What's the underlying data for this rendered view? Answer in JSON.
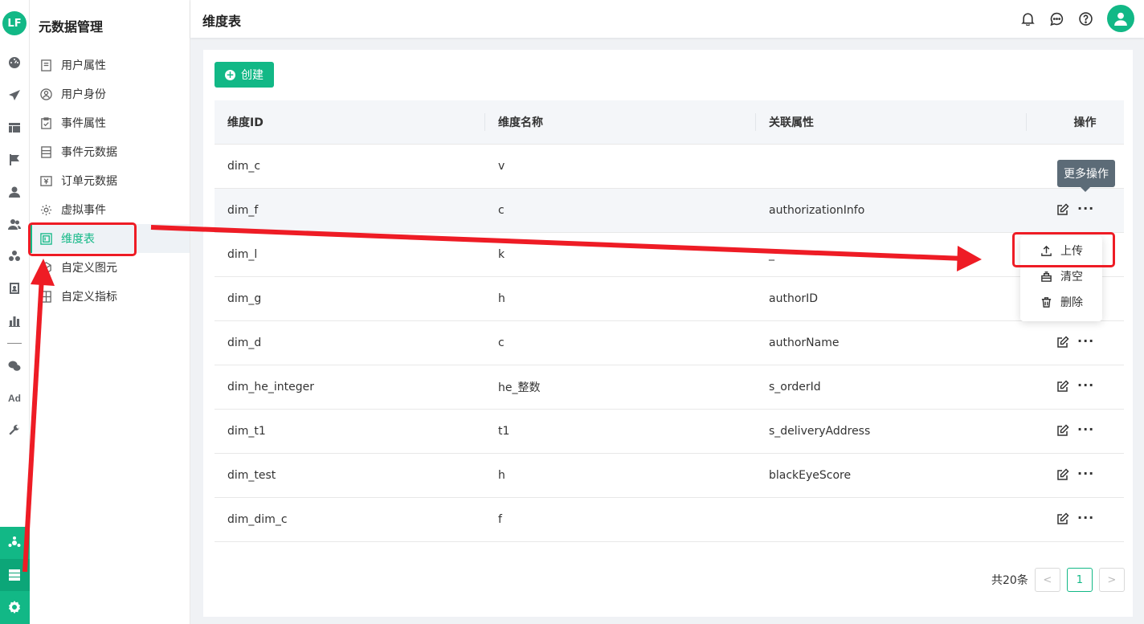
{
  "app": {
    "logo_text": "LF"
  },
  "rail": {
    "icons": [
      "dashboard-icon",
      "send-icon",
      "layout-icon",
      "flag-icon",
      "user-icon",
      "users-icon",
      "cluster-icon",
      "contacts-icon",
      "bar-chart-icon",
      "wechat-icon",
      "ad-icon",
      "wrench-icon"
    ],
    "ad_label": "Ad",
    "bottom_icons": [
      "hub-icon",
      "server-icon",
      "settings-icon"
    ]
  },
  "sidebar": {
    "title": "元数据管理",
    "items": [
      {
        "label": "用户属性",
        "icon": "user-attr-icon"
      },
      {
        "label": "用户身份",
        "icon": "user-identity-icon"
      },
      {
        "label": "事件属性",
        "icon": "event-attr-icon"
      },
      {
        "label": "事件元数据",
        "icon": "event-meta-icon"
      },
      {
        "label": "订单元数据",
        "icon": "order-meta-icon"
      },
      {
        "label": "虚拟事件",
        "icon": "virtual-event-icon"
      },
      {
        "label": "维度表",
        "icon": "dimension-table-icon",
        "active": true
      },
      {
        "label": "自定义图元",
        "icon": "custom-element-icon"
      },
      {
        "label": "自定义指标",
        "icon": "custom-metric-icon"
      }
    ]
  },
  "header": {
    "title": "维度表",
    "icons": [
      "bell-icon",
      "message-icon",
      "help-icon",
      "avatar-icon"
    ]
  },
  "toolbar": {
    "create_label": "创建"
  },
  "table": {
    "columns": [
      "维度ID",
      "维度名称",
      "关联属性",
      "操作"
    ],
    "rows": [
      {
        "id": "dim_c",
        "name": "v",
        "attr": ""
      },
      {
        "id": "dim_f",
        "name": "c",
        "attr": "authorizationInfo"
      },
      {
        "id": "dim_l",
        "name": "k",
        "attr": "_"
      },
      {
        "id": "dim_g",
        "name": "h",
        "attr": "authorID"
      },
      {
        "id": "dim_d",
        "name": "c",
        "attr": "authorName"
      },
      {
        "id": "dim_he_integer",
        "name": "he_整数",
        "attr": "s_orderId"
      },
      {
        "id": "dim_t1",
        "name": "t1",
        "attr": "s_deliveryAddress"
      },
      {
        "id": "dim_test",
        "name": "h",
        "attr": "blackEyeScore"
      },
      {
        "id": "dim_dim_c",
        "name": "f",
        "attr": ""
      }
    ]
  },
  "tooltip": {
    "text": "更多操作"
  },
  "dropdown": {
    "items": [
      {
        "label": "上传",
        "icon": "upload-icon"
      },
      {
        "label": "清空",
        "icon": "clear-icon"
      },
      {
        "label": "删除",
        "icon": "trash-icon"
      }
    ]
  },
  "pagination": {
    "total": "共20条",
    "current": "1",
    "prev": "<",
    "next": ">"
  },
  "colors": {
    "accent": "#12b886",
    "annotation": "#ee1c25"
  }
}
